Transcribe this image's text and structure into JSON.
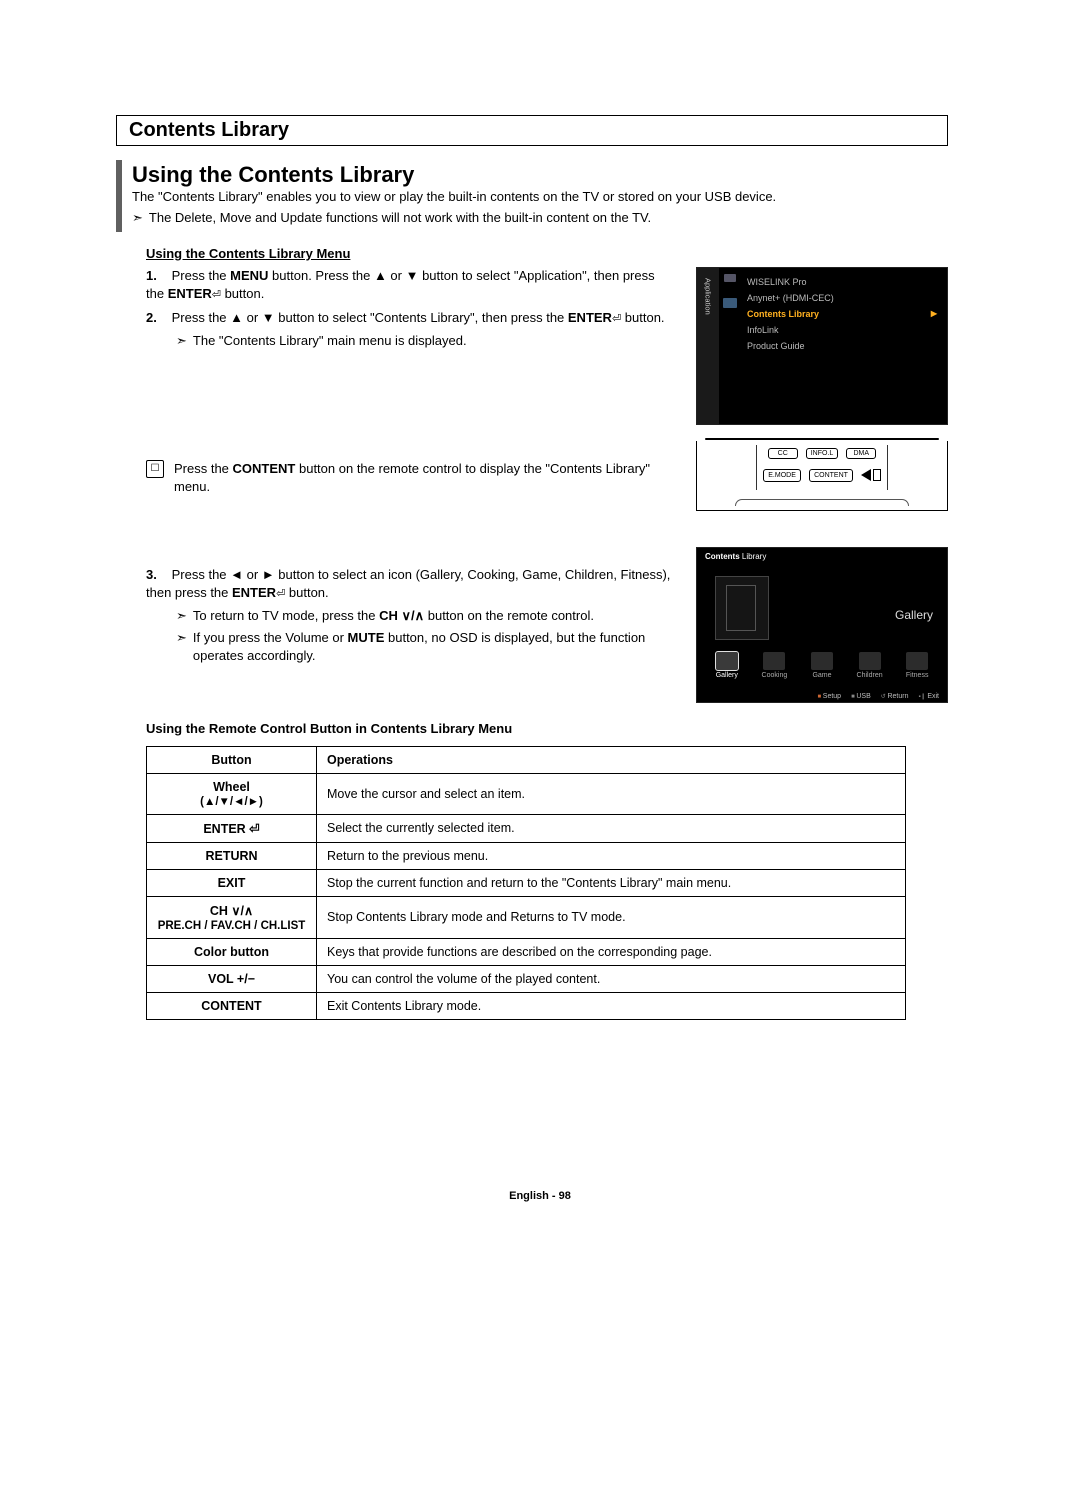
{
  "headings": {
    "h1": "Contents Library",
    "h2": "Using the Contents Library"
  },
  "intro": {
    "main": "The \"Contents Library\" enables you to view or play the built-in contents on the TV or stored on your USB device.",
    "bullet": "The Delete, Move and Update functions will not work with the built-in content on the TV."
  },
  "subhead1": "Using the Contents Library Menu",
  "steps": {
    "s1a": "Press the ",
    "s1_menu": "MENU",
    "s1b": " button. Press the ▲ or ▼ button to select \"Application\", then press the ",
    "s1_enter": "ENTER",
    "s1c": " button.",
    "s2a": "Press the ▲ or ▼ button to select \"Contents Library\", then press the ",
    "s2_enter": "ENTER",
    "s2b": " button.",
    "s2_bullet": "The \"Contents Library\" main menu is displayed.",
    "note1a": "Press the ",
    "note1_content": "CONTENT",
    "note1b": " button on the remote control to display the \"Contents Library\" menu.",
    "s3a": "Press the ◄ or ► button to select an icon (Gallery, Cooking, Game, Children, Fitness), then press the ",
    "s3_enter": "ENTER",
    "s3b": " button.",
    "s3_bullet1a": "To return to TV mode, press the ",
    "s3_bullet1_ch": "CH ∨/∧",
    "s3_bullet1b": " button on the remote control.",
    "s3_bullet2a": "If you press the Volume or ",
    "s3_bullet2_mute": "MUTE",
    "s3_bullet2b": " button, no OSD is displayed, but the function operates accordingly."
  },
  "osd": {
    "sidebar": "Application",
    "items": [
      "WISELINK Pro",
      "Anynet+ (HDMI-CEC)",
      "Contents Library",
      "InfoLink",
      "Product Guide"
    ]
  },
  "remote": {
    "row1": [
      "CC",
      "INFO.L",
      "DMA"
    ],
    "row2": [
      "E.MODE",
      "CONTENT"
    ]
  },
  "screenshot2": {
    "title_prefix": "Contents",
    "title_suffix": " Library",
    "label": "Gallery",
    "cats": [
      "Gallery",
      "Cooking",
      "Game",
      "Children",
      "Fitness"
    ],
    "bottom": [
      "Setup",
      "USB",
      "Return",
      "Exit"
    ]
  },
  "tablehead": "Using the Remote Control Button in Contents Library Menu",
  "table": {
    "head_button": "Button",
    "head_ops": "Operations",
    "rows": [
      {
        "btn": "Wheel",
        "sub": "(▲/▼/◄/►)",
        "op": "Move the cursor and select an item."
      },
      {
        "btn": "ENTER ⏎",
        "op": "Select the currently selected item."
      },
      {
        "btn": "RETURN",
        "op": "Return to the previous menu."
      },
      {
        "btn": "EXIT",
        "op": "Stop the current function and return to the \"Contents Library\" main menu."
      },
      {
        "btn": "CH ∨/∧",
        "sub": "PRE.CH / FAV.CH / CH.LIST",
        "op": "Stop Contents Library mode and Returns to TV mode."
      },
      {
        "btn": "Color button",
        "op": "Keys that provide functions are described on the corresponding page."
      },
      {
        "btn": "VOL +/−",
        "op": "You can control the volume of the played content."
      },
      {
        "btn": "CONTENT",
        "op": "Exit Contents Library mode."
      }
    ]
  },
  "footer": "English - 98",
  "glyph": {
    "enter": "⏎",
    "bullet": "➣"
  }
}
